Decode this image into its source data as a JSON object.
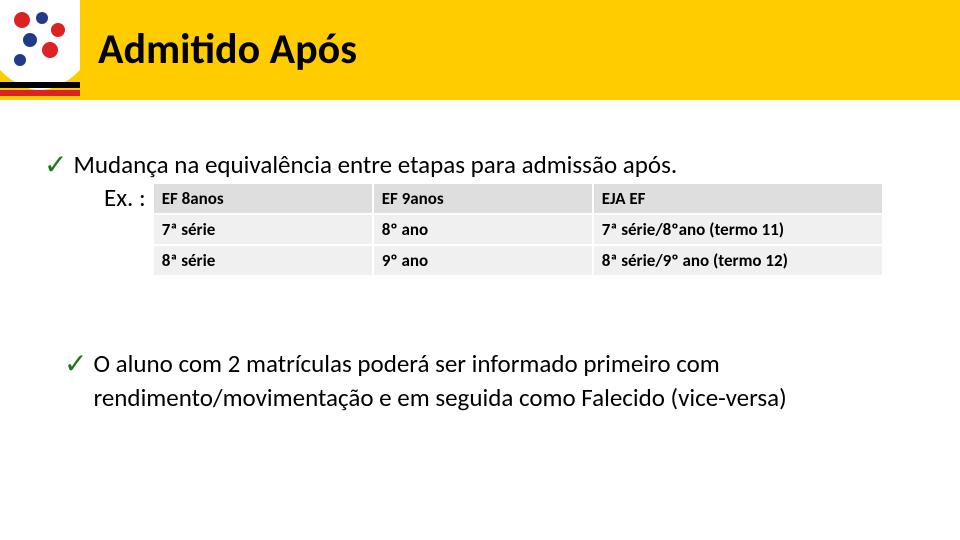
{
  "header": {
    "title": "Admitido Após"
  },
  "bullets": {
    "item1": "Mudança na equivalência entre etapas para admissão após.",
    "ex_label": "Ex. :",
    "item2": "O aluno com 2 matrículas poderá ser informado primeiro com rendimento/movimentação e em seguida como Falecido (vice-versa)"
  },
  "table": {
    "headers": {
      "c1": "EF 8anos",
      "c2": "EF 9anos",
      "c3": "EJA EF"
    },
    "rows": [
      {
        "c1": "7ª série",
        "c2": "8º ano",
        "c3": "7ª série/8ºano (termo 11)"
      },
      {
        "c1": "8ª série",
        "c2": "9º ano",
        "c3": "8ª série/9º ano (termo 12)"
      }
    ]
  }
}
